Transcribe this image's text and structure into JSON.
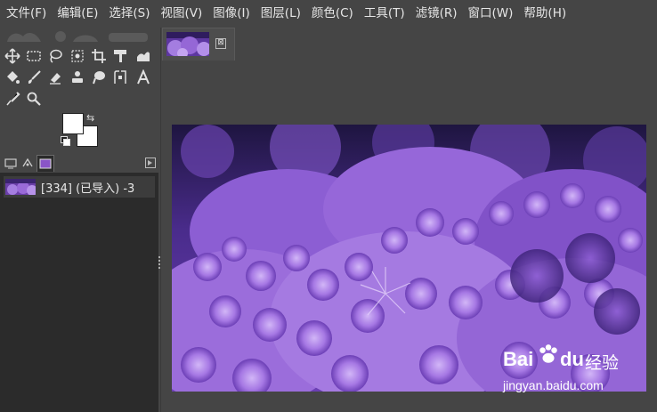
{
  "menubar": {
    "items": [
      "文件(F)",
      "编辑(E)",
      "选择(S)",
      "视图(V)",
      "图像(I)",
      "图层(L)",
      "颜色(C)",
      "工具(T)",
      "滤镜(R)",
      "窗口(W)",
      "帮助(H)"
    ]
  },
  "toolbox": {
    "tools": [
      "move-tool-icon",
      "rect-select-icon",
      "lasso-icon",
      "fuzzy-select-icon",
      "crop-icon",
      "transform-icon",
      "warp-icon",
      "bucket-fill-icon",
      "paintbrush-icon",
      "eraser-icon",
      "clone-icon",
      "smudge-icon",
      "path-icon",
      "text-icon",
      "color-picker-icon",
      "zoom-icon"
    ],
    "fg_color": "#ffffff",
    "bg_color": "#ffffff",
    "swap_glyph": "⇆"
  },
  "images_dock": {
    "items": [
      {
        "label": "[334] (已导入) -3"
      }
    ]
  },
  "image_tab": {
    "close_glyph": "⊠"
  },
  "watermark": {
    "brand_a": "Bai",
    "brand_b": "du",
    "brand_cn": "经验",
    "url": "jingyan.baidu.com"
  },
  "colors": {
    "panel": "#454545",
    "dock_bg": "#2b2b2b",
    "coral_purple": "#8a55c8"
  }
}
